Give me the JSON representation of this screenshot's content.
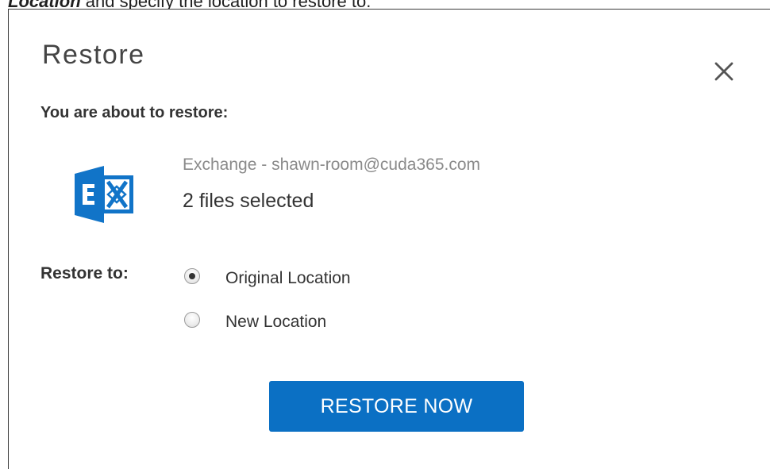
{
  "context": {
    "bold_text": "Location",
    "rest_text": " and specify the location to restore to."
  },
  "dialog": {
    "title": "Restore",
    "about_label": "You are about to restore:",
    "source": {
      "icon": "exchange-icon",
      "name": "Exchange - shawn-room@cuda365.com",
      "selection": "2 files selected"
    },
    "restore_to": {
      "label": "Restore to:",
      "options": [
        {
          "label": "Original Location",
          "checked": true
        },
        {
          "label": "New Location",
          "checked": false
        }
      ]
    },
    "primary_button": "RESTORE NOW"
  },
  "colors": {
    "accent": "#0b70c4",
    "exchange_blue": "#1174c8"
  }
}
